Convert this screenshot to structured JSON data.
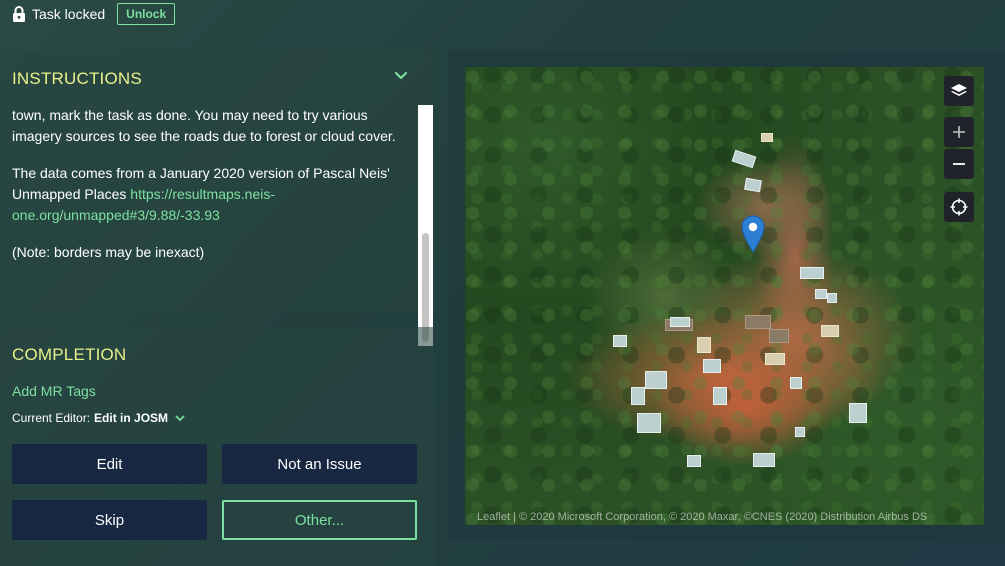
{
  "lockbar": {
    "status": "Task locked",
    "unlock_label": "Unlock",
    "icon": "lock-icon"
  },
  "instructions": {
    "title": "INSTRUCTIONS",
    "para1": "town, mark the task as done. You may need to try various imagery sources to see the roads due to forest or cloud cover.",
    "para2_text": "The data comes from a January 2020 version of Pascal Neis' Unmapped Places ",
    "para2_link": "https://resultmaps.neis-one.org/unmapped#3/9.88/-33.93",
    "para3": "(Note: borders may be inexact)",
    "scroll_position": 0.62
  },
  "completion": {
    "title": "COMPLETION",
    "add_tags": "Add MR Tags",
    "editor_label": "Current Editor:",
    "editor_value": "Edit in JOSM",
    "buttons": {
      "edit": "Edit",
      "not_issue": "Not an Issue",
      "skip": "Skip",
      "other": "Other..."
    }
  },
  "map": {
    "controls": [
      "layers-icon",
      "zoom-in-icon",
      "zoom-out-icon",
      "locate-icon"
    ],
    "attribution": "Leaflet | © 2020 Microsoft Corporation, © 2020 Maxar, ©CNES (2020) Distribution Airbus DS"
  },
  "colors": {
    "accent": "#7ee0a0",
    "heading": "#e8f08a",
    "button_bg": "#182843",
    "pin": "#2d7fd3"
  }
}
